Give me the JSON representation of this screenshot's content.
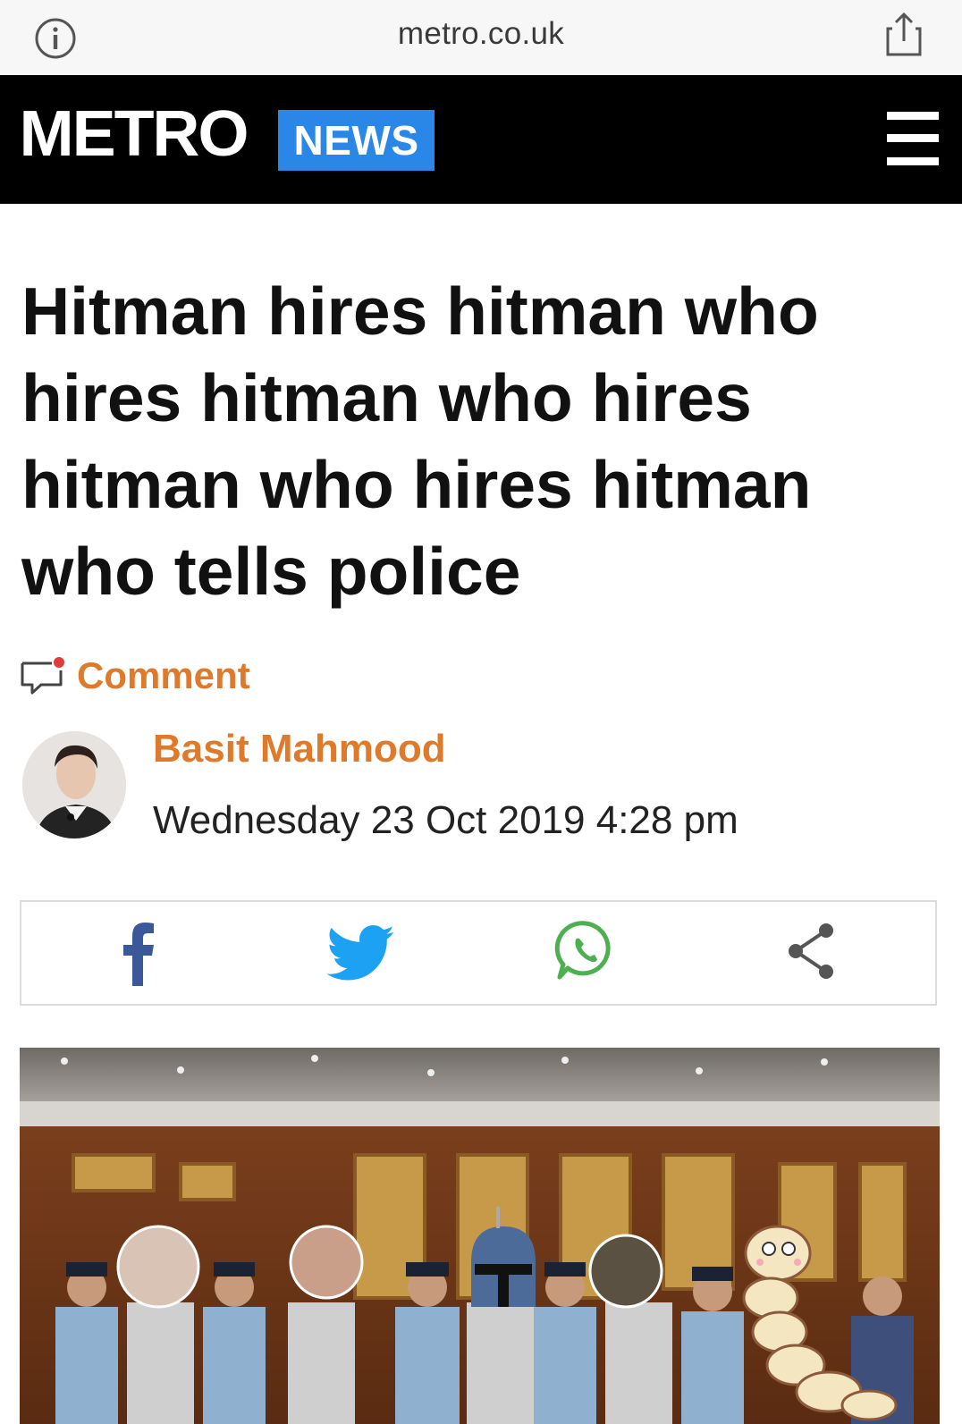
{
  "browser": {
    "url": "metro.co.uk"
  },
  "header": {
    "logo": "METRO",
    "section_badge": "NEWS"
  },
  "article": {
    "headline": "Hitman hires hitman who hires hitman who hires hitman who hires hitman who tells police",
    "comment_label": "Comment",
    "author": "Basit Mahmood",
    "date": "Wednesday 23 Oct 2019 4:28 pm"
  },
  "share": {
    "icons": [
      "facebook-icon",
      "twitter-icon",
      "whatsapp-icon",
      "share-icon"
    ]
  },
  "colors": {
    "header_bg": "#000000",
    "badge_blue": "#2a87e8",
    "accent_orange": "#de7a2c",
    "facebook": "#3b5998",
    "twitter": "#1da1f2",
    "whatsapp": "#4caf50"
  }
}
